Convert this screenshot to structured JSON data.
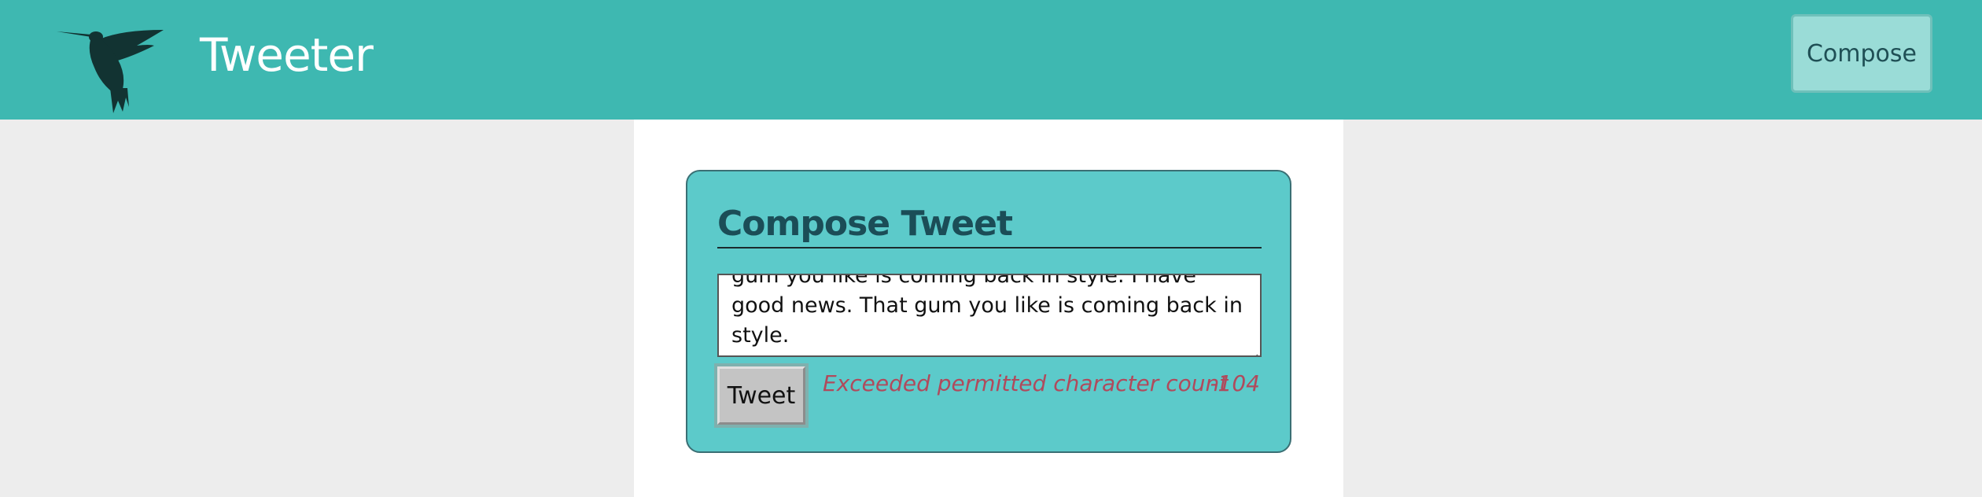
{
  "header": {
    "brand": "Tweeter",
    "logo_icon": "hummingbird-icon",
    "compose_label": "Compose",
    "background_color": "#3eb8b1"
  },
  "composer": {
    "title": "Compose Tweet",
    "tweet_text": "coming back in style. I have good news. That gum you like is coming back in style. I have good news. That gum you like is coming back in style.",
    "tweet_button": "Tweet",
    "error_message": "Exceeded permitted character count",
    "char_counter": "-104",
    "panel_color": "#5ccaca",
    "error_color": "#b04a5c"
  }
}
